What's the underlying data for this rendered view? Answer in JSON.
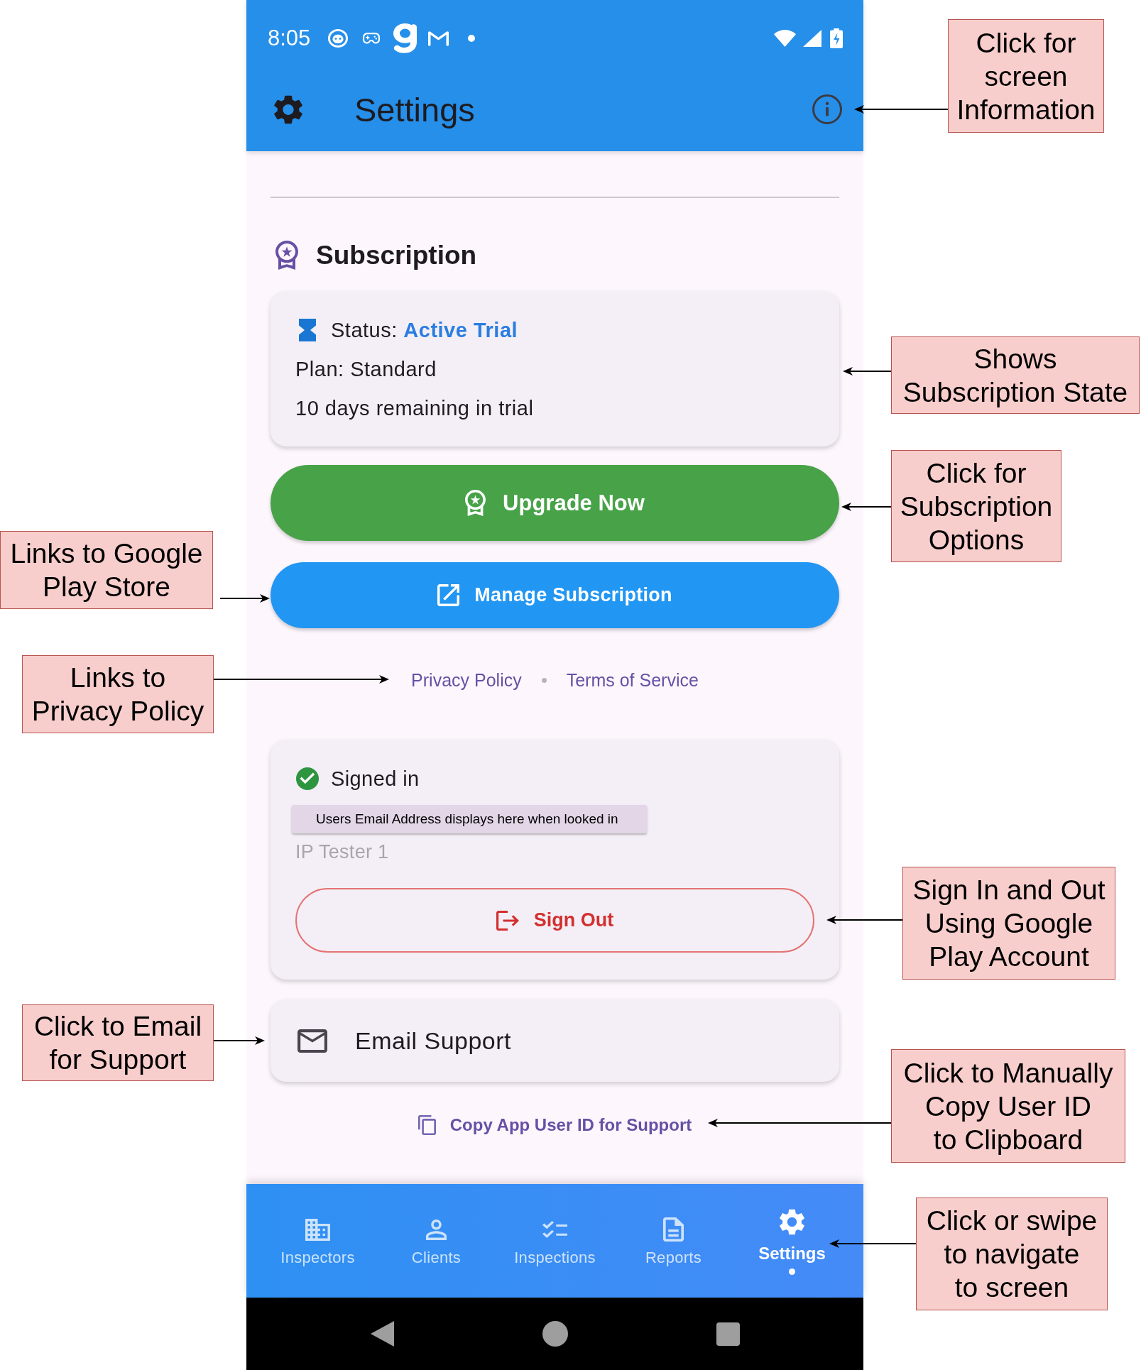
{
  "status_bar": {
    "time": "8:05"
  },
  "app_bar": {
    "title": "Settings"
  },
  "subscription": {
    "heading": "Subscription",
    "status": "Status: **Active Trial**",
    "plan": "Plan: Standard",
    "remaining": "10 days remaining in trial",
    "upgrade_button": "Upgrade Now",
    "manage_button": "Manage Subscription",
    "links": [
      {
        "label": "Privacy Policy"
      },
      {
        "label": "Terms of Service"
      }
    ]
  },
  "account": {
    "status": "Signed in",
    "tooltip": "Users Email Address displays here when looked in",
    "user_name": "IP Tester 1",
    "sign_out_button": "Sign Out"
  },
  "support": {
    "email_label": "Email Support",
    "copy_link": "Copy App User ID for Support"
  },
  "bottom_nav": {
    "items": [
      {
        "label": "Inspectors",
        "selected": false
      },
      {
        "label": "Clients",
        "selected": false
      },
      {
        "label": "Inspections",
        "selected": false
      },
      {
        "label": "Reports",
        "selected": false
      },
      {
        "label": "Settings",
        "selected": true
      }
    ]
  },
  "annotations": [
    {
      "text": "Click for\nscreen\nInformation"
    },
    {
      "text": "Shows\nSubscription State"
    },
    {
      "text": "Click for\nSubscription\nOptions"
    },
    {
      "text": "Links to Google\nPlay Store"
    },
    {
      "text": "Links to\nPrivacy Policy"
    },
    {
      "text": "Sign In and Out\nUsing Google\nPlay Account"
    },
    {
      "text": "Click to Email\nfor Support"
    },
    {
      "text": "Click to Manually\nCopy User ID\nto Clipboard"
    },
    {
      "text": "Click or swipe\nto navigate\nto screen"
    }
  ]
}
